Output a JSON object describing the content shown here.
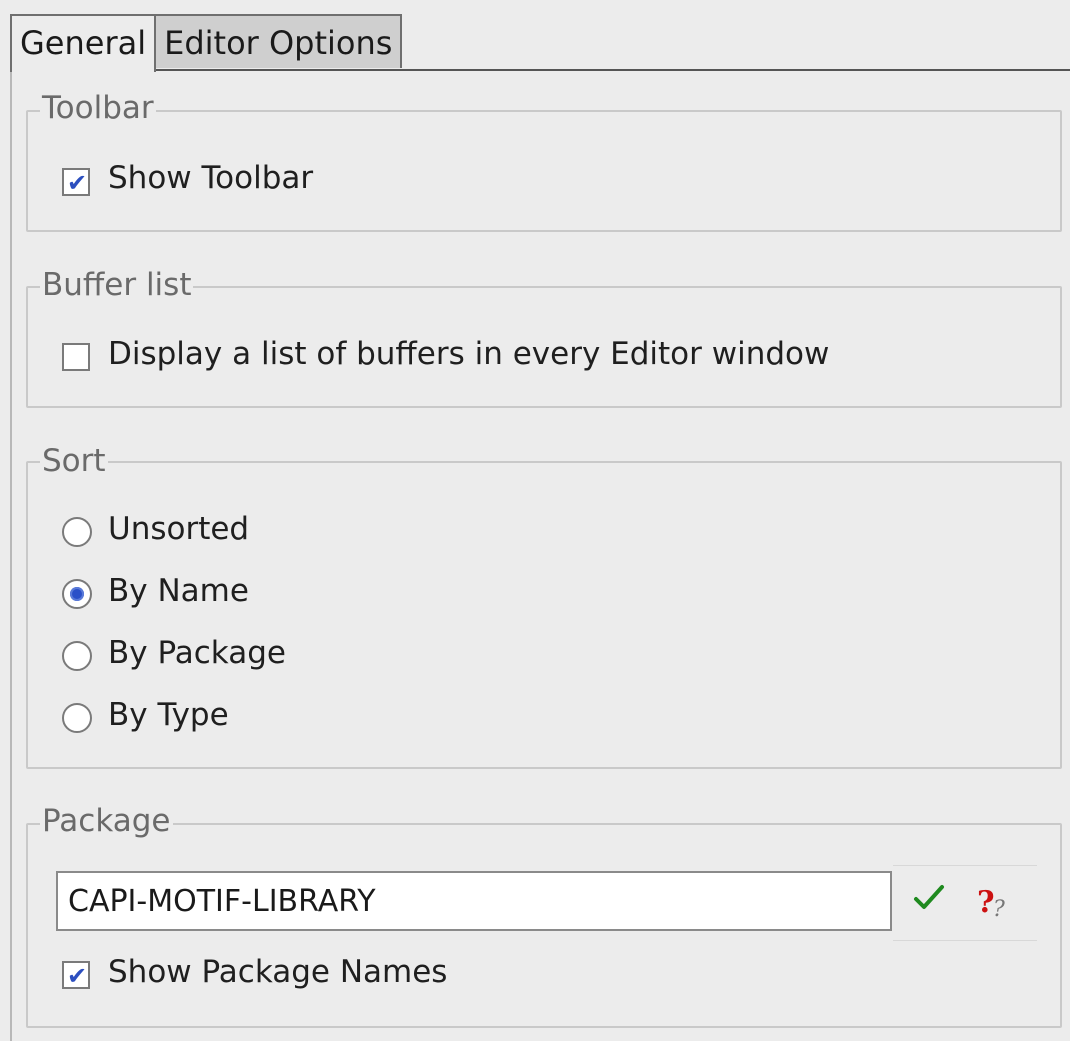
{
  "tabs": [
    {
      "label": "General",
      "active": true
    },
    {
      "label": "Editor Options",
      "active": false
    }
  ],
  "toolbar_group": {
    "title": "Toolbar",
    "show_toolbar": {
      "label": "Show Toolbar",
      "checked": true
    }
  },
  "buffer_list_group": {
    "title": "Buffer list",
    "display_list": {
      "label": "Display a list of buffers in every Editor window",
      "checked": false
    }
  },
  "sort_group": {
    "title": "Sort",
    "options": [
      {
        "label": "Unsorted",
        "selected": false
      },
      {
        "label": "By Name",
        "selected": true
      },
      {
        "label": "By Package",
        "selected": false
      },
      {
        "label": "By Type",
        "selected": false
      }
    ]
  },
  "package_group": {
    "title": "Package",
    "input_value": "CAPI-MOTIF-LIBRARY",
    "confirm_icon": "checkmark-icon",
    "help_icon": "question-mark-icon",
    "show_package_names": {
      "label": "Show Package Names",
      "checked": true
    }
  },
  "colors": {
    "check_blue": "#2c4fbf",
    "confirm_green": "#1f8a1f",
    "help_red": "#cc1111"
  }
}
